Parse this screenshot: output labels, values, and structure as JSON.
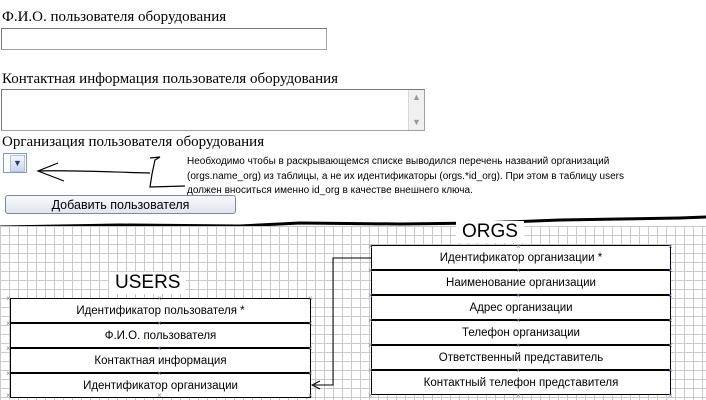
{
  "form": {
    "fio_label": "Ф.И.О. пользователя оборудования",
    "fio_value": "",
    "contact_label": "Контактная информация пользователя оборудования",
    "contact_value": "",
    "org_label": "Организация пользователя оборудования",
    "org_selected": "",
    "add_button_label": "Добавить пользователя"
  },
  "note": {
    "text": "Необходимо чтобы в раскрывающемся списке выводился перечень названий организаций (orgs.name_org) из таблицы, а не их идентификаторы (orgs.*id_org). При этом в таблицу users должен вноситься именно id_org в качестве внешнего ключа."
  },
  "diagram": {
    "orgs": {
      "title": "ORGS",
      "fields": [
        "Идентификатор организации *",
        "Наименование организации",
        "Адрес организации",
        "Телефон организации",
        "Ответственный представитель",
        "Контактный телефон представителя"
      ]
    },
    "users": {
      "title": "USERS",
      "fields": [
        "Идентификатор пользователя *",
        "Ф.И.О. пользователя",
        "Контактная информация",
        "Идентификатор организации"
      ]
    }
  },
  "icons": {
    "dropdown": "chevron-down-icon",
    "scroll_up": "scroll-up-icon",
    "scroll_down": "scroll-down-icon"
  }
}
